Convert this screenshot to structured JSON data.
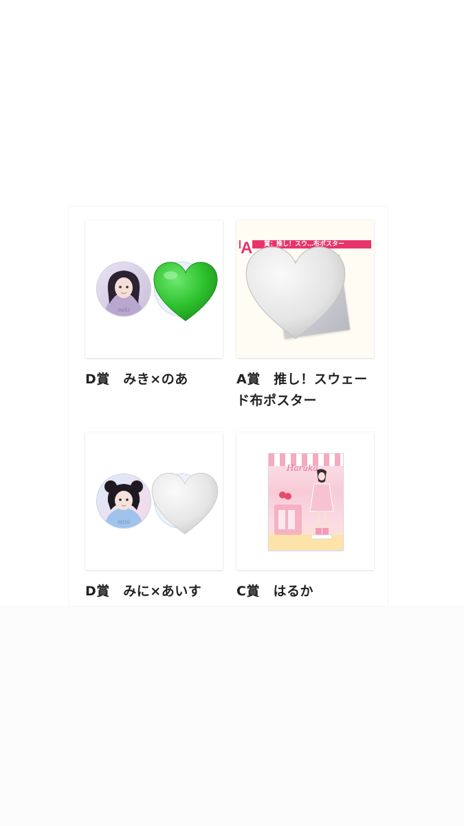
{
  "colors": {
    "label_text": "#222222",
    "green_heart": "#2fc22f",
    "white_heart": "#e6e6e6",
    "poster_accent": "#e8336b"
  },
  "items": [
    {
      "label": "D賞　みき×のあ",
      "heart": "green-heart-icon"
    },
    {
      "label": "A賞　推し！スウェード布ポスター",
      "heart": "white-heart-icon",
      "poster_letter": "A",
      "poster_title": "賞：推し！スウ…布ポスター"
    },
    {
      "label": "D賞　みに×あいす",
      "heart": "white-heart-icon"
    },
    {
      "label": "C賞　はるか",
      "stand_logo": "Haruka"
    }
  ]
}
